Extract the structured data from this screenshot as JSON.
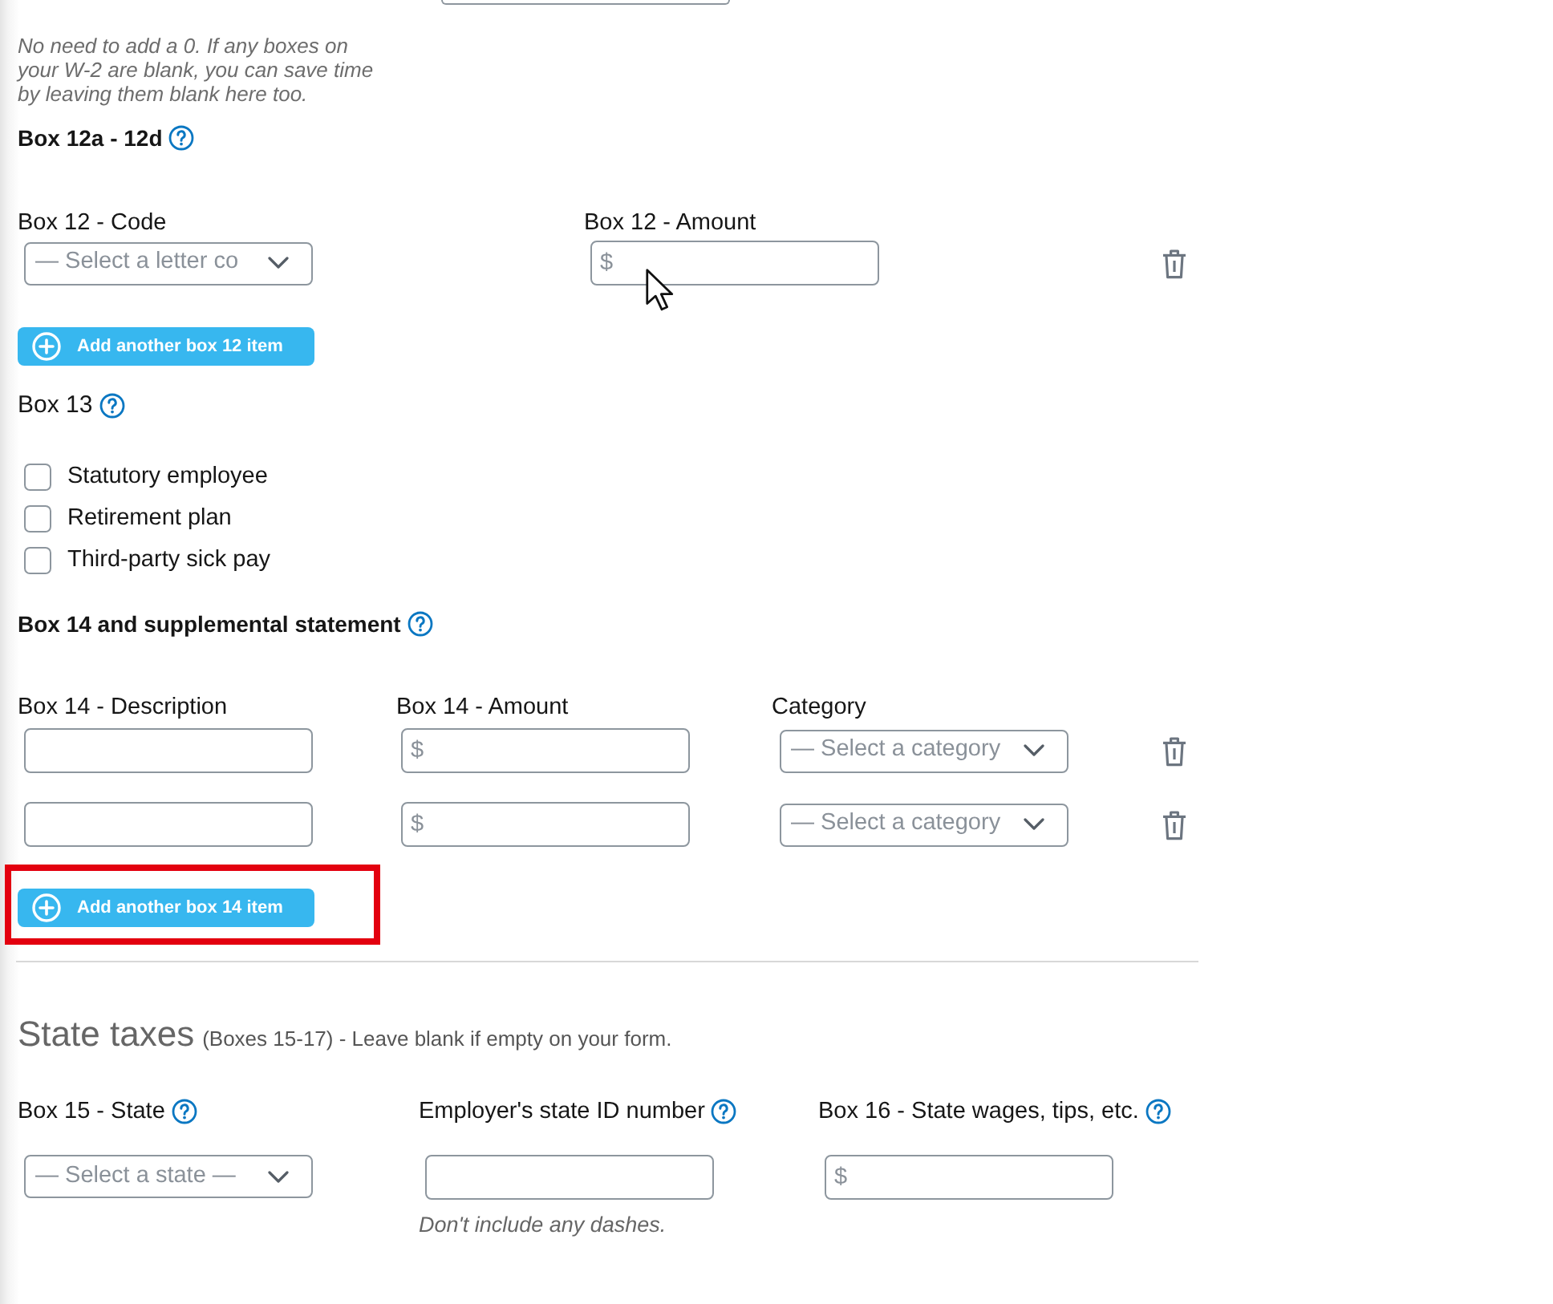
{
  "note": "No need to add a 0. If any boxes on your W-2 are blank, you can save time by leaving them blank here too.",
  "box12": {
    "heading": "Box 12a - 12d",
    "help": true,
    "columns": [
      "Box 12 - Code",
      "Box 12 - Amount"
    ],
    "rows": [
      {
        "code_placeholder": "— Select a letter co",
        "amount_placeholder": "$"
      }
    ],
    "add_button": {
      "label": "Add another box 12 item"
    }
  },
  "box13": {
    "heading": "Box 13",
    "help": true,
    "options": [
      {
        "label": "Statutory employee",
        "checked": false
      },
      {
        "label": "Retirement plan",
        "checked": false
      },
      {
        "label": "Third-party sick pay",
        "checked": false
      }
    ]
  },
  "box14": {
    "heading": "Box 14 and supplemental statement",
    "help": true,
    "columns": [
      "Box 14 - Description",
      "Box 14 - Amount",
      "Category"
    ],
    "rows": [
      {
        "amount_placeholder": "$",
        "category_placeholder": "— Select a category"
      },
      {
        "amount_placeholder": "$",
        "category_placeholder": "— Select a category"
      }
    ],
    "add_button": {
      "label": "Add another box 14 item",
      "highlighted": true
    }
  },
  "state_taxes": {
    "title": "State taxes",
    "subtitle": "(Boxes 15-17) - Leave blank if empty on your form.",
    "fields": [
      {
        "kind": "select",
        "label": "Box 15 - State",
        "help": true,
        "placeholder": "— Select a state —"
      },
      {
        "kind": "text",
        "label": "Employer's state ID number",
        "help": true,
        "hint": "Don't include any dashes."
      },
      {
        "kind": "text",
        "label": "Box 16 - State wages, tips, etc.",
        "help": true,
        "placeholder": "$"
      }
    ]
  }
}
